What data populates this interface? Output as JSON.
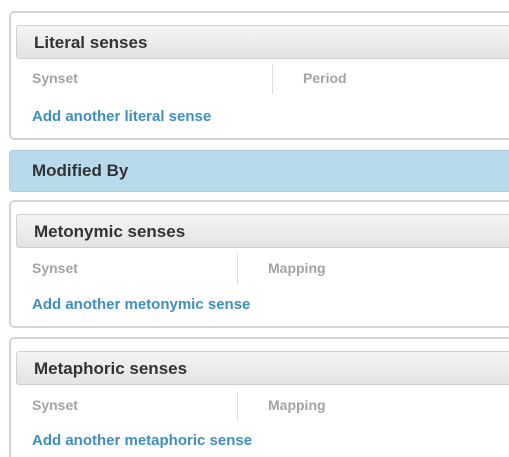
{
  "literal": {
    "title": "Literal senses",
    "columns": [
      "Synset",
      "Period"
    ],
    "add_link": "Add another literal sense"
  },
  "modified_by": {
    "title": "Modified By"
  },
  "metonymic": {
    "title": "Metonymic senses",
    "columns": [
      "Synset",
      "Mapping"
    ],
    "add_link": "Add another metonymic sense"
  },
  "metaphoric": {
    "title": "Metaphoric senses",
    "columns": [
      "Synset",
      "Mapping"
    ],
    "add_link": "Add another metaphoric sense"
  }
}
